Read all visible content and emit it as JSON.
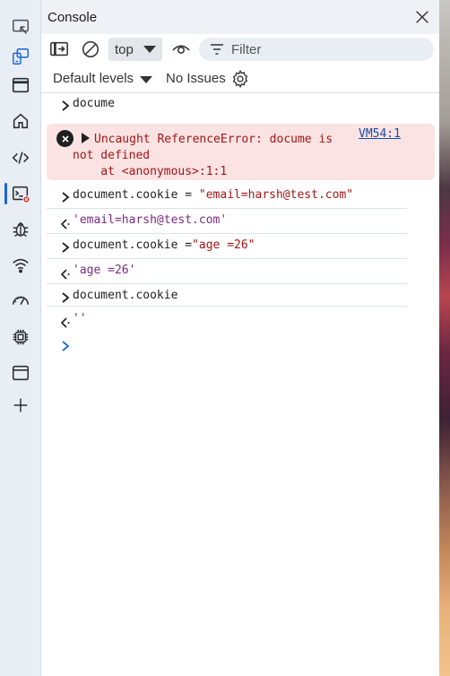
{
  "sidebar": {
    "items": [
      {
        "name": "screencast"
      },
      {
        "name": "device-emulation"
      },
      {
        "name": "elements-panel"
      },
      {
        "name": "welcome-home"
      },
      {
        "name": "sources"
      },
      {
        "name": "console-active"
      },
      {
        "name": "issues-bug"
      },
      {
        "name": "network-wifi"
      },
      {
        "name": "performance"
      },
      {
        "name": "memory-chip"
      },
      {
        "name": "application"
      },
      {
        "name": "more-tools-plus"
      }
    ],
    "accent": "#1a66d6"
  },
  "panel": {
    "title": "Console",
    "close_label": "Close"
  },
  "toolbar": {
    "context": "top",
    "filter_placeholder": "Filter",
    "levels": "Default levels",
    "issues": "No Issues"
  },
  "console": {
    "entries": [
      {
        "type": "input",
        "text": "docume"
      },
      {
        "type": "error",
        "message": "Uncaught ReferenceError: docume is",
        "message_cont": "not defined",
        "stack": "    at <anonymous>:1:1",
        "source_link": "VM54:1"
      },
      {
        "type": "input",
        "prefix": "document.cookie = ",
        "string": "\"email=harsh@test.com\""
      },
      {
        "type": "result",
        "text": "'email=harsh@test.com'"
      },
      {
        "type": "input",
        "prefix": "document.cookie =",
        "string": "\"age =26\""
      },
      {
        "type": "result",
        "text": "'age =26'"
      },
      {
        "type": "input",
        "text": "document.cookie"
      },
      {
        "type": "result",
        "text": "''"
      }
    ]
  },
  "colors": {
    "error_bg": "#fbe3e3",
    "error_text": "#a31515",
    "result_text": "#7a2a83",
    "link": "#1a4fa3"
  }
}
